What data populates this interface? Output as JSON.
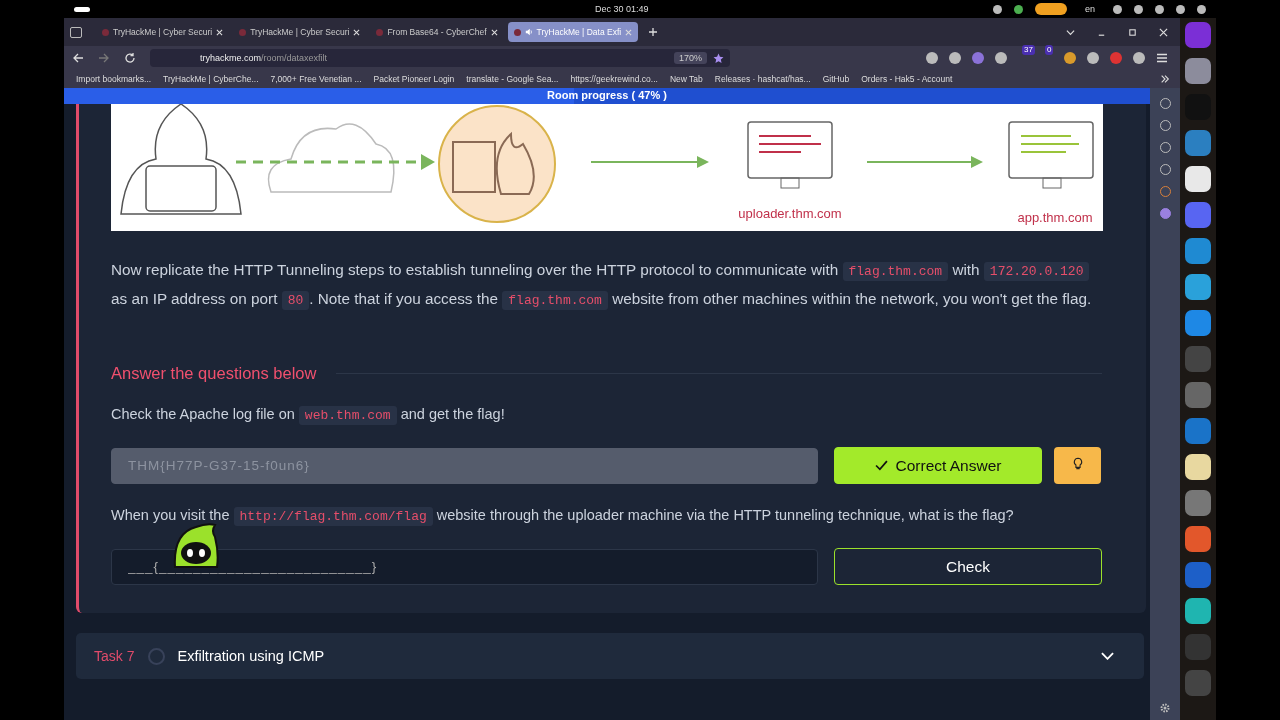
{
  "system_bar": {
    "clock": "Dec 30  01:49",
    "language": "en"
  },
  "tabs": [
    {
      "title": "TryHackMe | Cyber Securi",
      "selected": false,
      "audio": false
    },
    {
      "title": "TryHackMe | Cyber Securi",
      "selected": false,
      "audio": false
    },
    {
      "title": "From Base64 - CyberChef",
      "selected": false,
      "audio": false
    },
    {
      "title": "TryHackMe | Data Exfi",
      "selected": true,
      "audio": true
    }
  ],
  "address_bar": {
    "host": "tryhackme.com",
    "path": "/room/dataxexfilt",
    "zoom": "170%"
  },
  "extension_badges": [
    "37",
    "0"
  ],
  "bookmarks": [
    "Import bookmarks...",
    "TryHackMe | CyberChe...",
    "7,000+ Free Venetian ...",
    "Packet Pioneer Login",
    "translate - Google Sea...",
    "https://geekrewind.co...",
    "New Tab",
    "Releases · hashcat/has...",
    "GitHub",
    "Orders - Hak5 - Account"
  ],
  "progress": {
    "label": "Room progress ( 47% )",
    "level": 0.47
  },
  "diagram": {
    "labels": [
      "uploader.thm.com",
      "app.thm.com"
    ]
  },
  "paragraph": [
    {
      "kind": "text",
      "text": "Now replicate the HTTP Tunneling steps to establish tunneling over the HTTP protocol to communicate with "
    },
    {
      "kind": "code",
      "text": "flag.thm.com"
    },
    {
      "kind": "text",
      "text": " with "
    },
    {
      "kind": "code",
      "text": "172.20.0.120"
    },
    {
      "kind": "text",
      "text": " as an IP address on port "
    },
    {
      "kind": "code",
      "text": "80"
    },
    {
      "kind": "text",
      "text": ". Note that if you access the "
    },
    {
      "kind": "code",
      "text": "flag.thm.com"
    },
    {
      "kind": "text",
      "text": " website from other machines within the network, you won't get the flag."
    }
  ],
  "answer_heading": "Answer the questions below",
  "questions": [
    {
      "segments": [
        {
          "kind": "text",
          "text": "Check the Apache log file on "
        },
        {
          "kind": "code",
          "text": "web.thm.com"
        },
        {
          "kind": "text",
          "text": " and get the flag!"
        }
      ],
      "value": "THM{H77P-G37-15-f0un6}",
      "correct": true,
      "button": "Correct Answer",
      "hint": true
    },
    {
      "segments": [
        {
          "kind": "text",
          "text": "When you visit the "
        },
        {
          "kind": "code",
          "text": "http://flag.thm.com/flag"
        },
        {
          "kind": "text",
          "text": " website through the uploader machine via the HTTP tunneling technique, what is the flag?"
        }
      ],
      "placeholder": "___{_________________________}",
      "correct": false,
      "button": "Check",
      "hint": false
    }
  ],
  "next_task": {
    "label": "Task 7",
    "title": "Exfiltration using ICMP",
    "completed": false,
    "expanded": false
  }
}
